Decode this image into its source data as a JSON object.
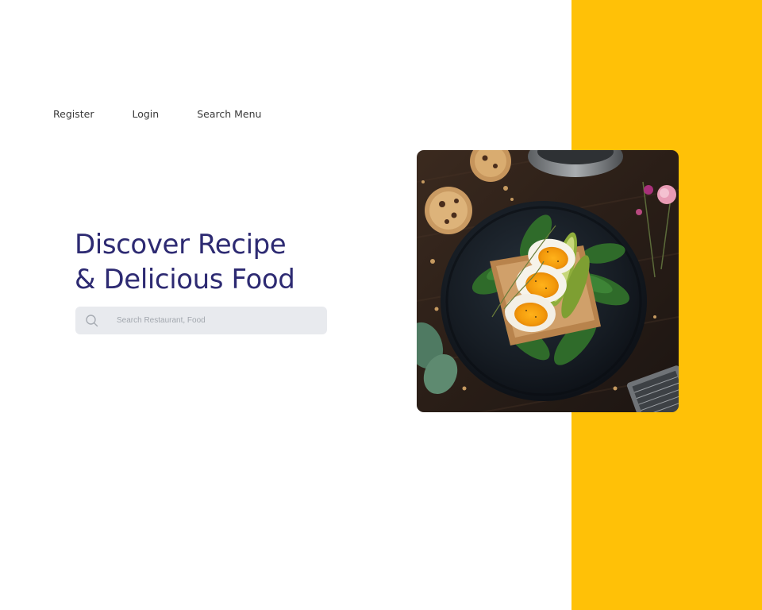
{
  "nav": {
    "items": [
      {
        "label": "Register"
      },
      {
        "label": "Login"
      },
      {
        "label": "Search Menu"
      }
    ]
  },
  "hero": {
    "title_line1": "Discover Recipe",
    "title_line2": "& Delicious Food"
  },
  "search": {
    "placeholder": "Search Restaurant, Food",
    "icon": "search-icon"
  },
  "image": {
    "subject": "egg-avocado-toast-on-dark-plate"
  },
  "colors": {
    "accent": "#FFC107",
    "title": "#2D2A72",
    "search_bg": "#E8EAEE",
    "nav_text": "#3A3A3A"
  }
}
